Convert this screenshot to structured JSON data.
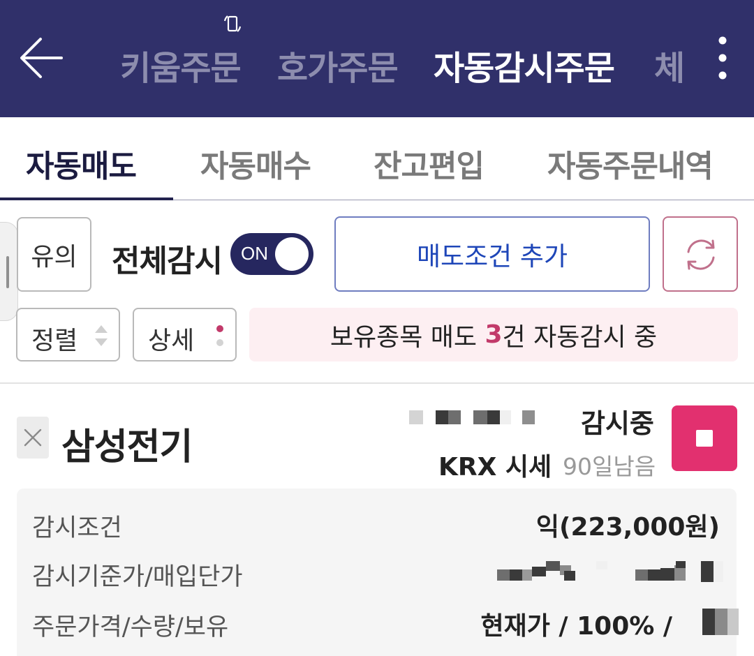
{
  "header": {
    "tabs": [
      {
        "label": "키움주문",
        "active": false
      },
      {
        "label": "호가주문",
        "active": false
      },
      {
        "label": "자동감시주문",
        "active": true
      },
      {
        "label": "체",
        "active": false
      }
    ],
    "icons": {
      "back": "arrow-left-icon",
      "rotate": "phone-rotate-icon",
      "more": "more-vertical-icon"
    },
    "background_color": "#30306a"
  },
  "subtabs": [
    {
      "label": "자동매도",
      "active": true
    },
    {
      "label": "자동매수",
      "active": false
    },
    {
      "label": "잔고편입",
      "active": false
    },
    {
      "label": "자동주문내역",
      "active": false
    }
  ],
  "controls": {
    "notice_label": "유의",
    "monitor_all_label": "전체감시",
    "toggle_label": "ON",
    "toggle_on": true,
    "add_condition_label": "매도조건 추가",
    "refresh_icon": "refresh-icon",
    "sort_label": "정렬",
    "detail_label": "상세"
  },
  "status_banner": {
    "prefix": "보유종목 매도 ",
    "count": "3",
    "suffix": "건 자동감시 중"
  },
  "stock": {
    "name": "삼성전기",
    "status": "감시중",
    "market": "KRX 시세",
    "days_left": "90일남음",
    "stop_icon": "stop-icon",
    "remove_icon": "close-icon",
    "details": [
      {
        "label": "감시조건",
        "value": "익(223,000원)"
      },
      {
        "label": "감시기준가/매입단가",
        "value": ""
      },
      {
        "label": "주문가격/수량/보유",
        "value": "현재가 / 100% /"
      }
    ]
  },
  "colors": {
    "accent_navy": "#26275f",
    "accent_pink": "#e2306f",
    "accent_blue": "#1e46b8",
    "highlight_count": "#c23a6a"
  }
}
